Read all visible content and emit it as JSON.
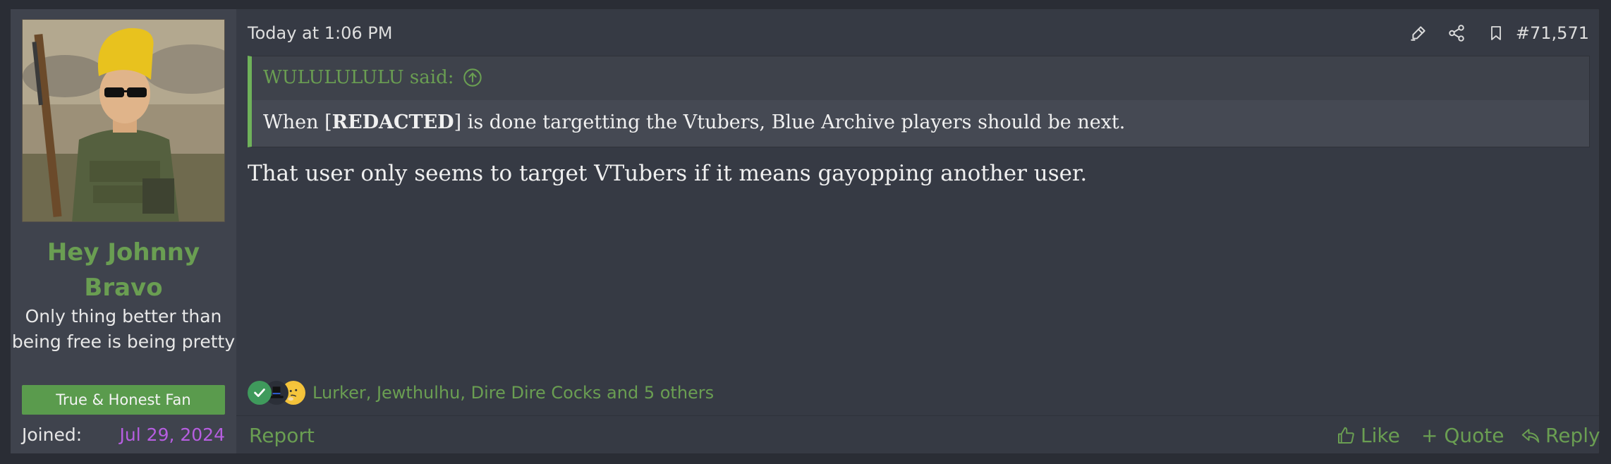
{
  "user": {
    "name": "Hey Johnny Bravo",
    "title": "Only thing better than being free is being pretty",
    "banner": "True & Honest Fan",
    "joined_label": "Joined:",
    "joined_value": "Jul 29, 2024"
  },
  "post": {
    "date": "Today at 1:06 PM",
    "number": "#71,571",
    "quote": {
      "author": "WULULULULU said:",
      "text_before": "When [",
      "text_bold": "REDACTED",
      "text_after": "] is done targetting the Vtubers, Blue Archive players should be next."
    },
    "message": "That user only seems to target VTubers if it means gayopping another user.",
    "reactions": {
      "list": "Lurker, Jewthulhu, Dire Dire Cocks and 5 others",
      "icons": [
        "check-reaction-icon",
        "tophat-reaction-icon",
        "thinking-face-reaction-icon"
      ]
    }
  },
  "footer": {
    "report": "Report",
    "like": "Like",
    "quote": "+ Quote",
    "reply": "Reply"
  },
  "colors": {
    "accent_green": "#6a9e52",
    "joined_purple": "#b65ee0",
    "banner_green": "#5a9b4d"
  }
}
